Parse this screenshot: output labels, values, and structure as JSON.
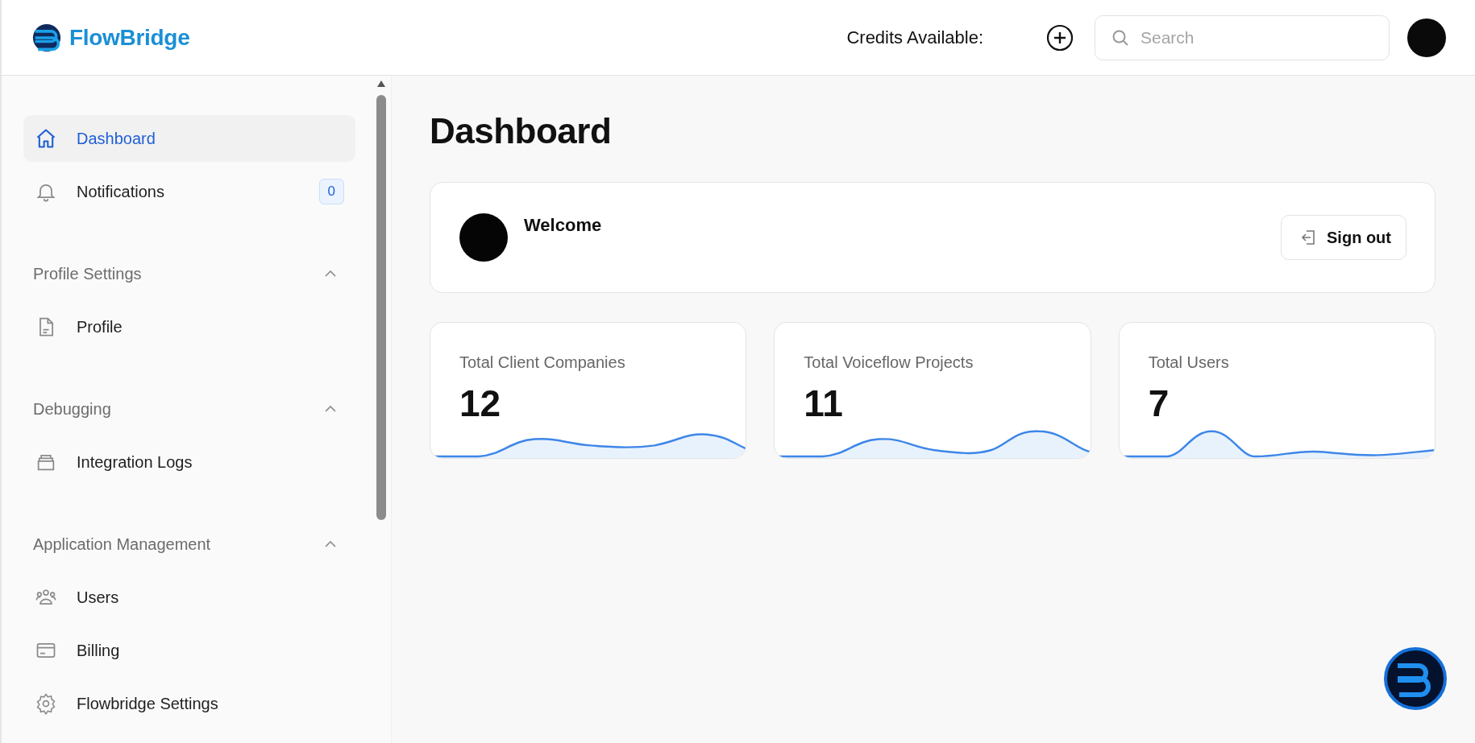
{
  "header": {
    "brand": "FlowBridge",
    "credits_label": "Credits Available:",
    "search": {
      "placeholder": "Search"
    }
  },
  "sidebar": {
    "items": [
      {
        "kind": "link",
        "label": "Dashboard",
        "selected": true
      },
      {
        "kind": "link",
        "label": "Notifications",
        "selected": false,
        "badge": "0"
      },
      {
        "kind": "section",
        "label": "Profile Settings",
        "expanded": true,
        "children": [
          {
            "label": "Profile",
            "selected": false
          }
        ]
      },
      {
        "kind": "section",
        "label": "Debugging",
        "expanded": true,
        "children": [
          {
            "label": "Integration Logs",
            "selected": false
          }
        ]
      },
      {
        "kind": "section",
        "label": "Application Management",
        "expanded": true,
        "children": [
          {
            "label": "Users",
            "selected": false
          },
          {
            "label": "Billing",
            "selected": false
          },
          {
            "label": "Flowbridge Settings",
            "selected": false
          }
        ]
      }
    ]
  },
  "main": {
    "title": "Dashboard",
    "welcome": {
      "greeting": "Welcome",
      "sign_out": "Sign out"
    },
    "stats": [
      {
        "label": "Total Client Companies",
        "value": "12"
      },
      {
        "label": "Total Voiceflow Projects",
        "value": "11"
      },
      {
        "label": "Total Users",
        "value": "7"
      }
    ]
  }
}
